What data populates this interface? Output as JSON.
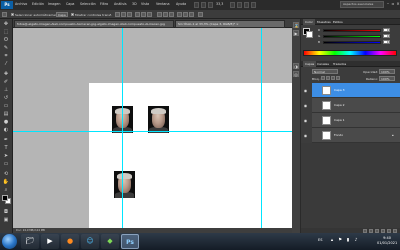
{
  "menubar": {
    "logo": "Ps",
    "items": [
      "Archivo",
      "Edición",
      "Imagen",
      "Capa",
      "Selección",
      "Filtro",
      "Análisis",
      "3D",
      "Vista",
      "Ventana",
      "Ayuda"
    ],
    "zoom": "33,3",
    "workspace": "Aspectos esenciales"
  },
  "options_bar": {
    "auto_select_label": "Seleccionar automáticamente:",
    "auto_select_value": "Capa",
    "transform_label": "Mostrar controles transf."
  },
  "document_tabs": [
    {
      "title": "fotos@-elgato-imagen-Aleli-compuesto-ALmacen-jpg-elgato-imagen-Aleli-compuesto-ALmacen-jpg",
      "active": false
    },
    {
      "title": "Sin título-1 al 33,3% (Capa 3, RGB/8)*",
      "active": true
    }
  ],
  "status": "Doc: 24,9 MB/2,04 MB",
  "panels": {
    "color_tabs": [
      "Color",
      "Muestras",
      "Estilos"
    ],
    "sliders": [
      {
        "label": "R",
        "value": "0",
        "color_start": "#000000",
        "color_end": "#ff0000"
      },
      {
        "label": "G",
        "value": "0",
        "color_start": "#000000",
        "color_end": "#00ff00"
      },
      {
        "label": "B",
        "value": "0",
        "color_start": "#000000",
        "color_end": "#0000ff"
      }
    ],
    "layers_tabs": [
      "Capas",
      "Canales",
      "Trazados"
    ],
    "blend_mode": "Normal",
    "opacity_label": "Opacidad:",
    "opacity_value": "100%",
    "lock_label": "Bloq.:",
    "fill_label": "Relleno:",
    "fill_value": "100%",
    "layers": [
      {
        "name": "Capa 3",
        "selected": true
      },
      {
        "name": "Capa 2",
        "selected": false
      },
      {
        "name": "Capa 1",
        "selected": false
      },
      {
        "name": "Fondo",
        "selected": false
      }
    ]
  },
  "taskbar": {
    "language": "ES",
    "time": "9:40",
    "date": "01/01/2021"
  },
  "colors": {
    "accent": "#3d8ee5",
    "guide": "#00e6ff",
    "canvas": "#ffffff"
  }
}
